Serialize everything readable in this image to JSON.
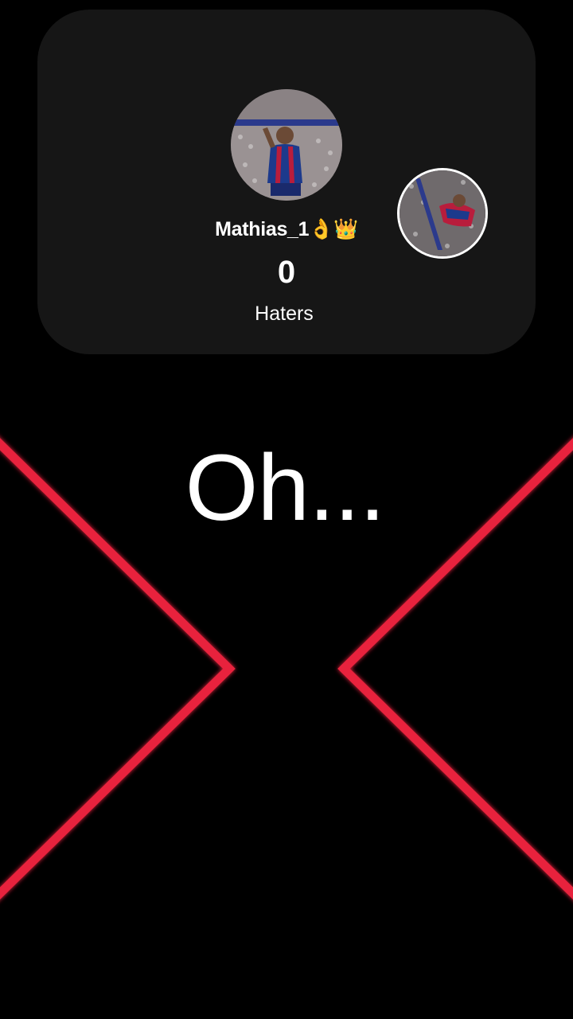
{
  "profile": {
    "username": "Mathias_1👌👑",
    "count": "0",
    "count_label": "Haters"
  },
  "overlay": {
    "text": "Oh..."
  },
  "colors": {
    "background": "#000000",
    "card": "#161616",
    "accent_red": "#e8213d",
    "text": "#ffffff"
  },
  "icons": {
    "avatar": "profile-photo-avatar",
    "secondary_avatar": "secondary-profile-photo"
  }
}
